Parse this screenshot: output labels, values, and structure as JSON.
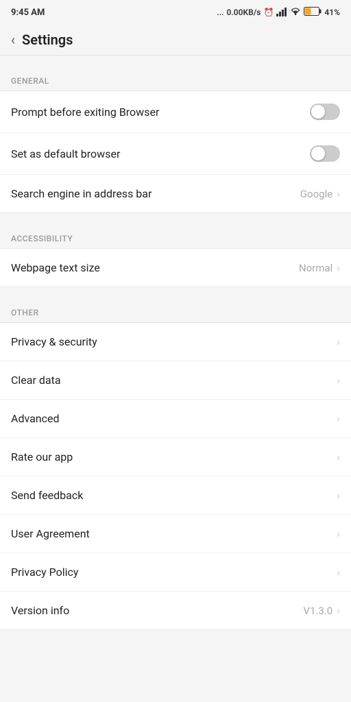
{
  "statusBar": {
    "time": "9:45 AM",
    "network": "...",
    "speed": "0.00KB/s",
    "alarm": "⏰",
    "signal": "📶",
    "wifi": "WiFi",
    "battery": "41%"
  },
  "header": {
    "back_label": "‹",
    "title": "Settings"
  },
  "sections": [
    {
      "id": "general",
      "label": "GENERAL",
      "items": [
        {
          "id": "prompt-exit",
          "label": "Prompt before exiting Browser",
          "type": "toggle",
          "toggle_on": false
        },
        {
          "id": "default-browser",
          "label": "Set as default browser",
          "type": "toggle",
          "toggle_on": false
        },
        {
          "id": "search-engine",
          "label": "Search engine in address bar",
          "type": "value",
          "value": "Google"
        }
      ]
    },
    {
      "id": "accessibility",
      "label": "ACCESSIBILITY",
      "items": [
        {
          "id": "text-size",
          "label": "Webpage text size",
          "type": "value",
          "value": "Normal"
        }
      ]
    },
    {
      "id": "other",
      "label": "OTHER",
      "items": [
        {
          "id": "privacy-security",
          "label": "Privacy & security",
          "type": "arrow"
        },
        {
          "id": "clear-data",
          "label": "Clear data",
          "type": "arrow"
        },
        {
          "id": "advanced",
          "label": "Advanced",
          "type": "arrow"
        },
        {
          "id": "rate-app",
          "label": "Rate our app",
          "type": "arrow"
        },
        {
          "id": "send-feedback",
          "label": "Send feedback",
          "type": "arrow"
        },
        {
          "id": "user-agreement",
          "label": "User Agreement",
          "type": "arrow"
        },
        {
          "id": "privacy-policy",
          "label": "Privacy Policy",
          "type": "arrow"
        },
        {
          "id": "version-info",
          "label": "Version info",
          "type": "value",
          "value": "V1.3.0"
        }
      ]
    }
  ]
}
